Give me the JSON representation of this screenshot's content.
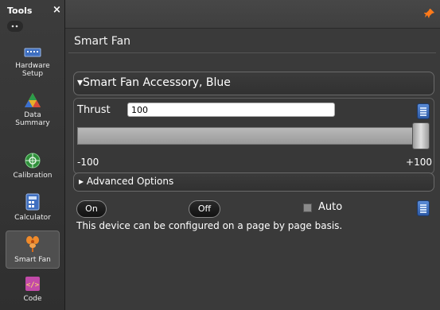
{
  "sidebar": {
    "title": "Tools",
    "close_icon": "×",
    "items": [
      {
        "label": "Hardware\nSetup",
        "icon": "hardware-icon"
      },
      {
        "label": "Data\nSummary",
        "icon": "data-summary-icon"
      },
      {
        "label": "Calibration",
        "icon": "calibration-icon"
      },
      {
        "label": "Calculator",
        "icon": "calculator-icon"
      },
      {
        "label": "Smart Fan",
        "icon": "smart-fan-icon",
        "active": true
      },
      {
        "label": "Code",
        "icon": "code-icon"
      }
    ]
  },
  "page": {
    "title": "Smart Fan"
  },
  "device": {
    "name": "Smart Fan Accessory, Blue",
    "thrust_label": "Thrust",
    "thrust_value": "100",
    "slider_min": "-100",
    "slider_max": "+100",
    "slider_value": 100,
    "advanced_label": "Advanced Options",
    "on_label": "On",
    "off_label": "Off",
    "auto_label": "Auto",
    "auto_checked": false,
    "info": "This device can be configured on a page by page basis."
  },
  "colors": {
    "pin": "#ff7a1a",
    "accent_blue": "#3f6fc0"
  }
}
